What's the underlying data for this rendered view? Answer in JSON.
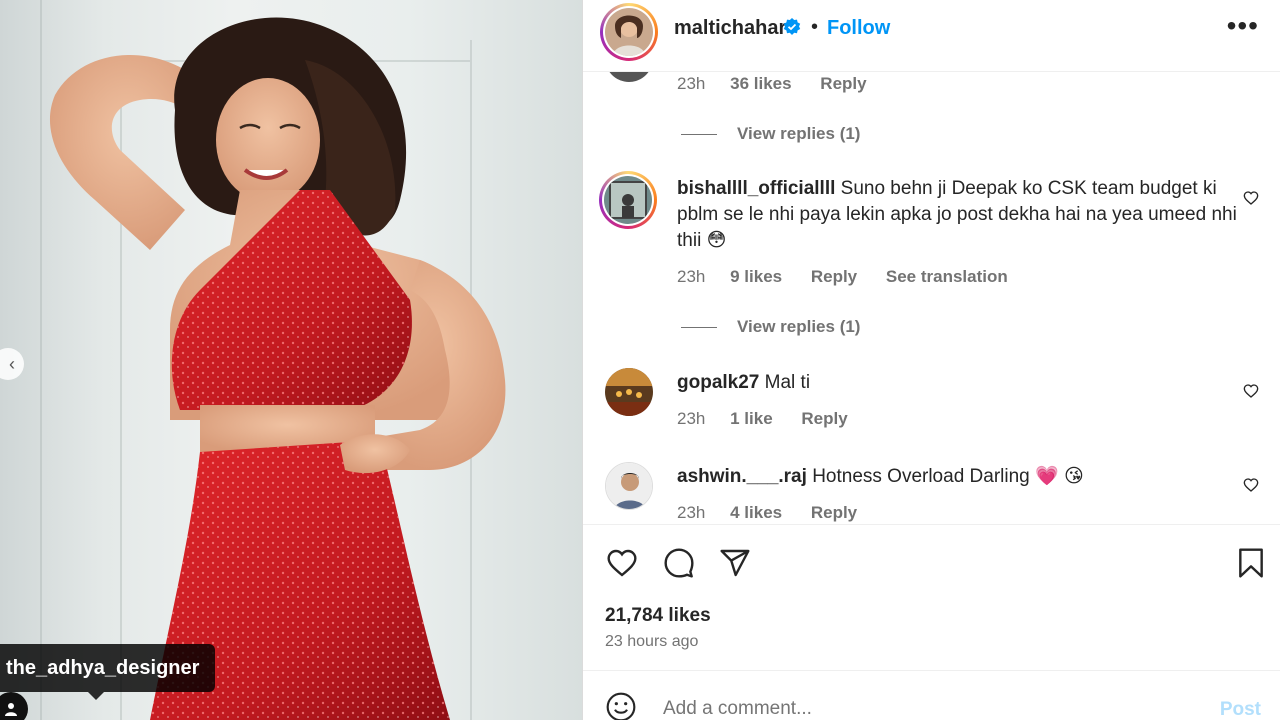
{
  "post": {
    "username": "maltichahar",
    "follow_label": "Follow",
    "separator": "•",
    "image_tag": "the_adhya_designer",
    "likes": "21,784 likes",
    "time_ago": "23 hours ago",
    "comment_placeholder": "Add a comment...",
    "post_label": "Post"
  },
  "comments": [
    {
      "time": "23h",
      "likes": "36 likes",
      "reply": "Reply",
      "view_replies": "View replies (1)"
    },
    {
      "username": "bishallll_officiallll",
      "text": "Suno behn ji Deepak ko CSK team budget ki pblm se le nhi paya lekin apka jo post dekha hai na yea umeed nhi thii 😳",
      "time": "23h",
      "likes": "9 likes",
      "reply": "Reply",
      "translation": "See translation",
      "view_replies": "View replies (1)"
    },
    {
      "username": "gopalk27",
      "text": "Mal ti",
      "time": "23h",
      "likes": "1 like",
      "reply": "Reply"
    },
    {
      "username": "ashwin.___.raj",
      "text": "Hotness Overload Darling 💗 😘",
      "time": "23h",
      "likes": "4 likes",
      "reply": "Reply"
    }
  ],
  "colors": {
    "accent": "#0095f6",
    "muted": "#737373",
    "text": "#262626",
    "dress_red": "#c81a1f"
  },
  "icons": [
    "chevron-left-icon",
    "user-tag-icon",
    "verified-icon",
    "more-icon",
    "heart-icon",
    "comment-icon",
    "share-icon",
    "bookmark-icon",
    "smile-icon"
  ]
}
